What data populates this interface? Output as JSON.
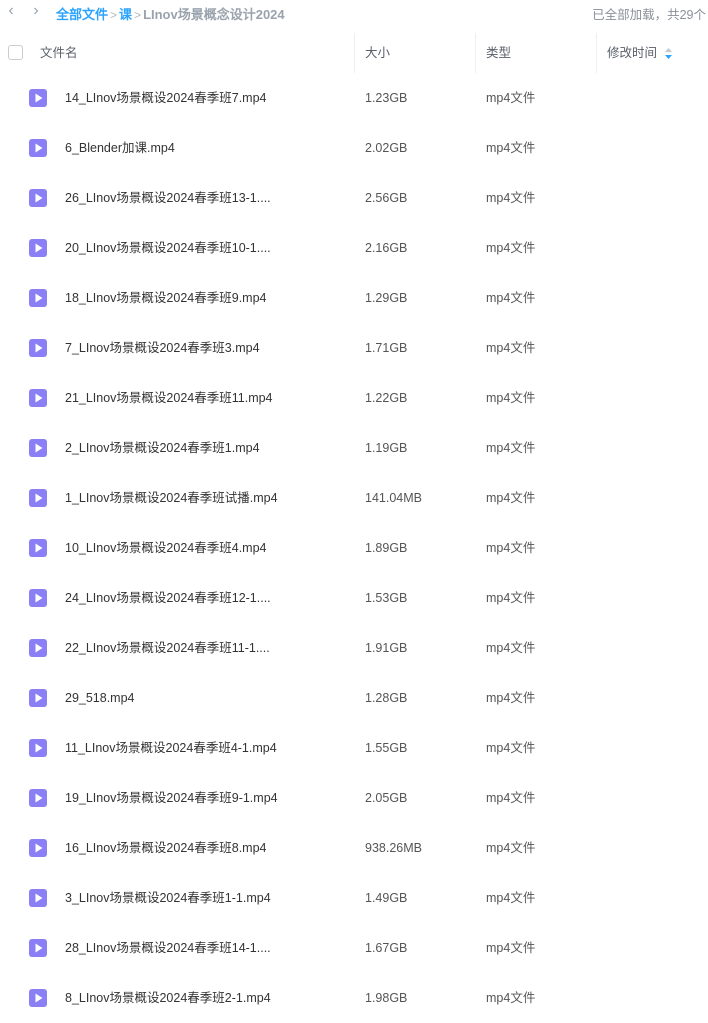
{
  "breadcrumb": {
    "back_icon": "chevron-left-icon",
    "forward_icon": "chevron-right-icon",
    "root": "全部文件",
    "middle": "课",
    "current": "LInov场景概念设计2024",
    "separator": ">"
  },
  "status_text": "已全部加载，共29个",
  "columns": {
    "name": "文件名",
    "size": "大小",
    "type": "类型",
    "modified": "修改时间"
  },
  "colors": {
    "accent": "#2ba3ff",
    "video_icon": "#8b7ff5"
  },
  "files": [
    {
      "name": "14_LInov场景概设2024春季班7.mp4",
      "size": "1.23GB",
      "type": "mp4文件"
    },
    {
      "name": "6_Blender加课.mp4",
      "size": "2.02GB",
      "type": "mp4文件"
    },
    {
      "name": "26_LInov场景概设2024春季班13-1....",
      "size": "2.56GB",
      "type": "mp4文件"
    },
    {
      "name": "20_LInov场景概设2024春季班10-1....",
      "size": "2.16GB",
      "type": "mp4文件"
    },
    {
      "name": "18_LInov场景概设2024春季班9.mp4",
      "size": "1.29GB",
      "type": "mp4文件"
    },
    {
      "name": "7_LInov场景概设2024春季班3.mp4",
      "size": "1.71GB",
      "type": "mp4文件"
    },
    {
      "name": "21_LInov场景概设2024春季班11.mp4",
      "size": "1.22GB",
      "type": "mp4文件"
    },
    {
      "name": "2_LInov场景概设2024春季班1.mp4",
      "size": "1.19GB",
      "type": "mp4文件"
    },
    {
      "name": "1_LInov场景概设2024春季班试播.mp4",
      "size": "141.04MB",
      "type": "mp4文件"
    },
    {
      "name": "10_LInov场景概设2024春季班4.mp4",
      "size": "1.89GB",
      "type": "mp4文件"
    },
    {
      "name": "24_LInov场景概设2024春季班12-1....",
      "size": "1.53GB",
      "type": "mp4文件"
    },
    {
      "name": "22_LInov场景概设2024春季班11-1....",
      "size": "1.91GB",
      "type": "mp4文件"
    },
    {
      "name": "29_518.mp4",
      "size": "1.28GB",
      "type": "mp4文件"
    },
    {
      "name": "11_LInov场景概设2024春季班4-1.mp4",
      "size": "1.55GB",
      "type": "mp4文件"
    },
    {
      "name": "19_LInov场景概设2024春季班9-1.mp4",
      "size": "2.05GB",
      "type": "mp4文件"
    },
    {
      "name": "16_LInov场景概设2024春季班8.mp4",
      "size": "938.26MB",
      "type": "mp4文件"
    },
    {
      "name": "3_LInov场景概设2024春季班1-1.mp4",
      "size": "1.49GB",
      "type": "mp4文件"
    },
    {
      "name": "28_LInov场景概设2024春季班14-1....",
      "size": "1.67GB",
      "type": "mp4文件"
    },
    {
      "name": "8_LInov场景概设2024春季班2-1.mp4",
      "size": "1.98GB",
      "type": "mp4文件"
    }
  ]
}
